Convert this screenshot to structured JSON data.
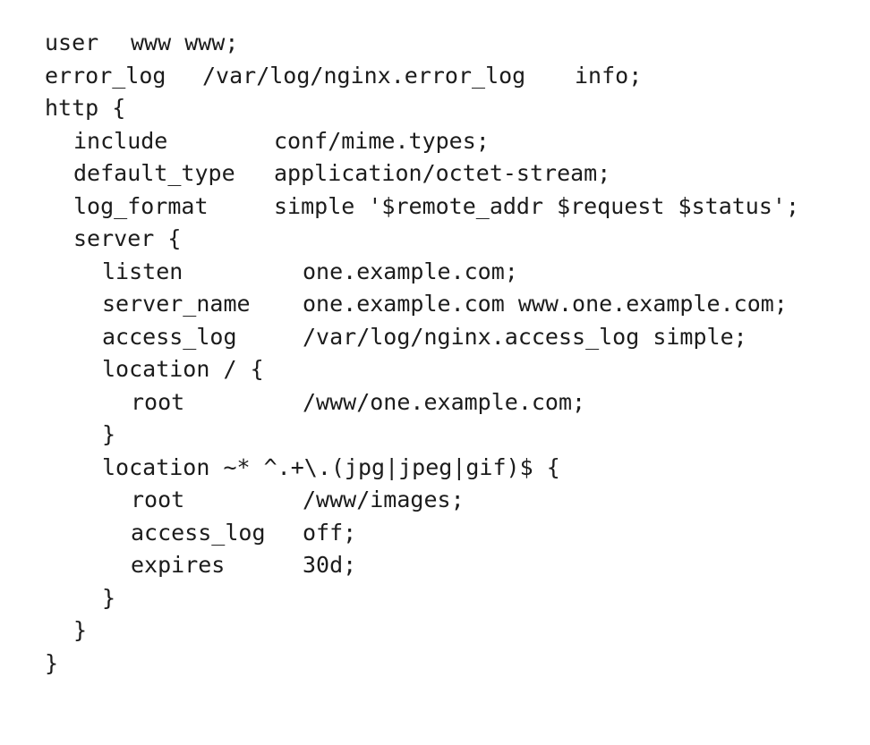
{
  "code": {
    "line1": {
      "keyword": "user",
      "value": "www www;"
    },
    "line2": {
      "keyword": "error_log",
      "value": "/var/log/nginx.error_log",
      "level": "info;"
    },
    "line3": {
      "text": "http {"
    },
    "line4": {
      "keyword": "include",
      "value": "conf/mime.types;"
    },
    "line5": {
      "keyword": "default_type",
      "value": "application/octet-stream;"
    },
    "line6": {
      "keyword": "log_format",
      "value": "simple '$remote_addr $request $status';"
    },
    "line7": {
      "text": "server {"
    },
    "line8": {
      "keyword": "listen",
      "value": "one.example.com;"
    },
    "line9": {
      "keyword": "server_name",
      "value": "one.example.com www.one.example.com;"
    },
    "line10": {
      "keyword": "access_log",
      "value": "/var/log/nginx.access_log simple;"
    },
    "line11": {
      "text": "location / {"
    },
    "line12": {
      "keyword": "root",
      "value": "/www/one.example.com;"
    },
    "line13": {
      "text": "}"
    },
    "line14": {
      "text": "location ~* ^.+\\.(jpg|jpeg|gif)$ {"
    },
    "line15": {
      "keyword": "root",
      "value": "/www/images;"
    },
    "line16": {
      "keyword": "access_log",
      "value": "off;"
    },
    "line17": {
      "keyword": "expires",
      "value": "30d;"
    },
    "line18": {
      "text": "}"
    },
    "line19": {
      "text": "}"
    },
    "line20": {
      "text": "}"
    }
  }
}
